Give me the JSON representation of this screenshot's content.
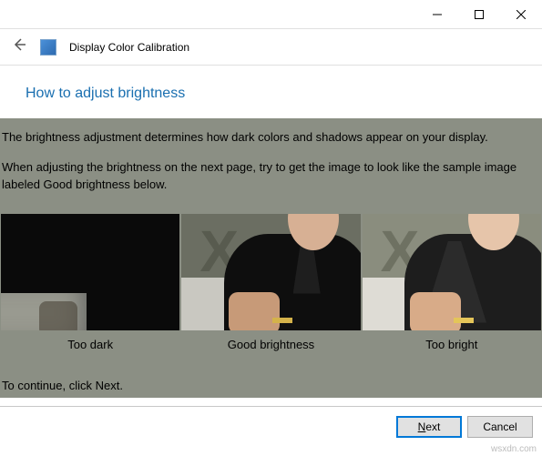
{
  "titlebar": {
    "minimize": "—",
    "maximize": "▢",
    "close": "✕"
  },
  "header": {
    "title": "Display Color Calibration"
  },
  "heading": "How to adjust brightness",
  "body": {
    "p1": "The brightness adjustment determines how dark colors and shadows appear on your display.",
    "p2": "When adjusting the brightness on the next page, try to get the image to look like the sample image labeled Good brightness below.",
    "continue": "To continue, click Next."
  },
  "samples": {
    "too_dark": {
      "label": "Too dark"
    },
    "good": {
      "label": "Good brightness"
    },
    "too_bright": {
      "label": "Too bright"
    }
  },
  "footer": {
    "next": "Next",
    "cancel": "Cancel"
  },
  "watermark": "wsxdn.com"
}
